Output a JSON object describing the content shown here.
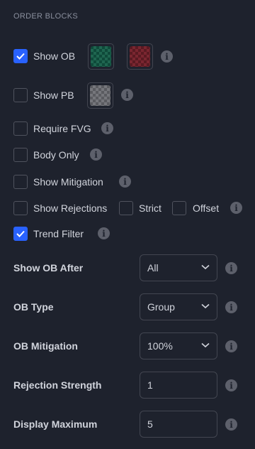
{
  "section": {
    "title": "ORDER BLOCKS"
  },
  "checkboxes": {
    "show_ob": {
      "label": "Show OB",
      "checked": true
    },
    "show_pb": {
      "label": "Show PB",
      "checked": false
    },
    "require_fvg": {
      "label": "Require FVG",
      "checked": false
    },
    "body_only": {
      "label": "Body Only",
      "checked": false
    },
    "show_mitigation": {
      "label": "Show Mitigation",
      "checked": false
    },
    "show_rejections": {
      "label": "Show Rejections",
      "checked": false
    },
    "strict": {
      "label": "Strict",
      "checked": false
    },
    "offset": {
      "label": "Offset",
      "checked": false
    },
    "trend_filter": {
      "label": "Trend Filter",
      "checked": true
    }
  },
  "colors": {
    "ob_bull": "#0f4a3a",
    "ob_bear": "#5a1a22",
    "pb": "#5a5b60",
    "accent": "#2962ff"
  },
  "settings": {
    "show_ob_after": {
      "label": "Show OB After",
      "value": "All"
    },
    "ob_type": {
      "label": "OB Type",
      "value": "Group"
    },
    "ob_mitigation": {
      "label": "OB Mitigation",
      "value": "100%"
    },
    "rejection_strength": {
      "label": "Rejection Strength",
      "value": "1"
    },
    "display_maximum": {
      "label": "Display Maximum",
      "value": "5"
    }
  },
  "icons": {
    "info": "info-icon",
    "check": "check-icon",
    "chevron": "chevron-down-icon"
  }
}
